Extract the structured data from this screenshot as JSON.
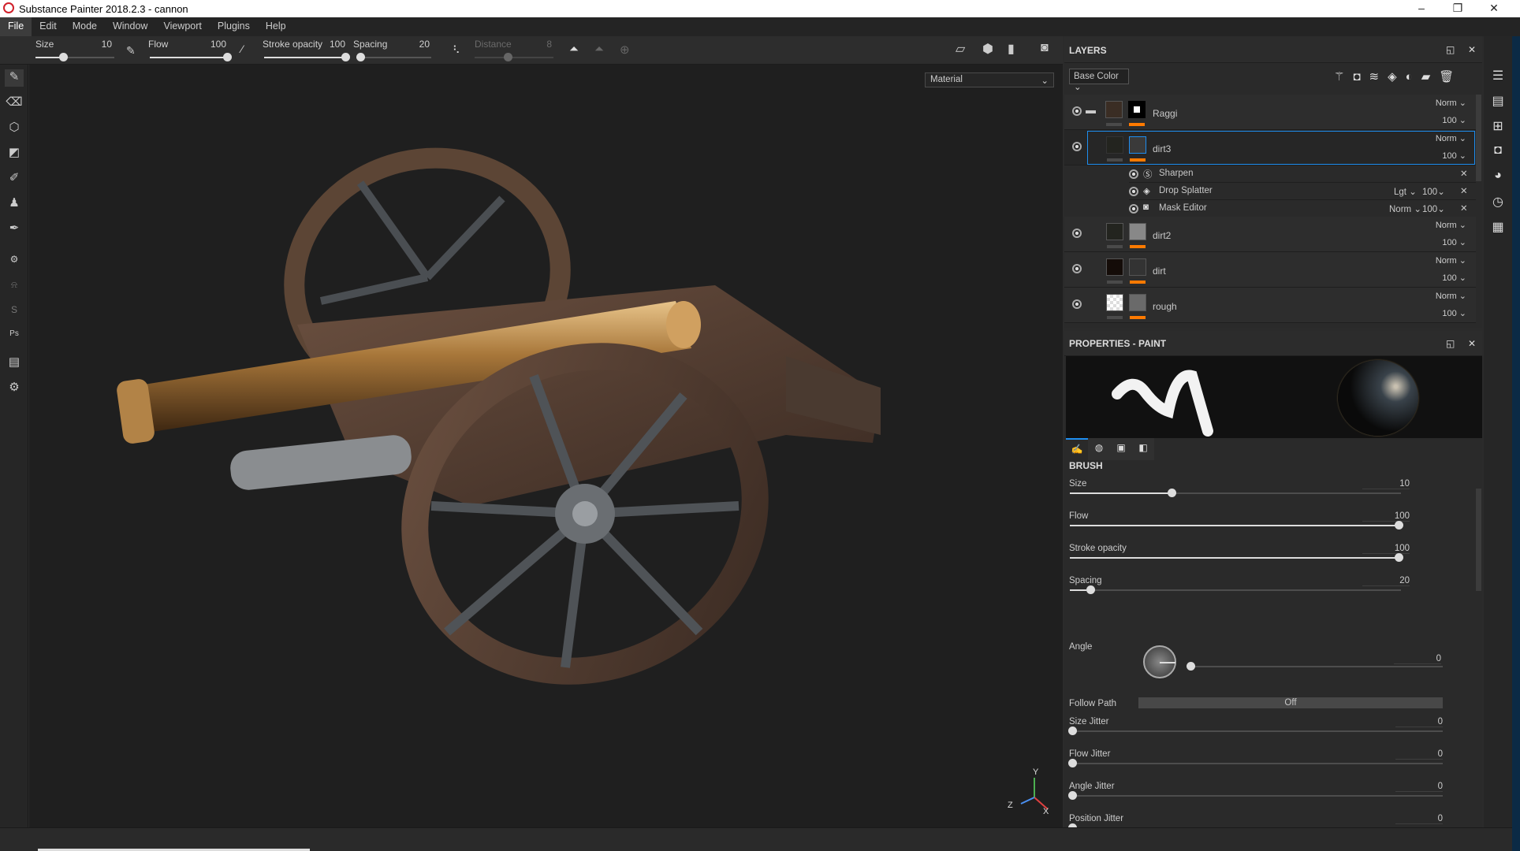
{
  "window": {
    "title": "Substance Painter 2018.2.3 - cannon",
    "minimize": "–",
    "maximize": "❐",
    "close": "✕"
  },
  "menu": [
    "File",
    "Edit",
    "Mode",
    "Window",
    "Viewport",
    "Plugins",
    "Help"
  ],
  "toolbar": {
    "size_label": "Size",
    "size_value": "10",
    "size_fraction": 0.35,
    "flow_label": "Flow",
    "flow_value": "100",
    "flow_fraction": 1.0,
    "stroke_label": "Stroke opacity",
    "stroke_value": "100",
    "stroke_fraction": 1.0,
    "spacing_label": "Spacing",
    "spacing_value": "20",
    "spacing_fraction": 0.05,
    "distance_label": "Distance",
    "distance_value": "8",
    "distance_fraction": 0.4
  },
  "viewport": {
    "channel": "Material",
    "axis_y": "Y",
    "axis_z": "Z",
    "axis_x": "X"
  },
  "layers": {
    "title": "LAYERS",
    "channel": "Base Color",
    "items": [
      {
        "name": "Raggi",
        "blend": "Norm",
        "opacity": "100"
      },
      {
        "name": "dirt3",
        "blend": "Norm",
        "opacity": "100"
      },
      {
        "name": "dirt2",
        "blend": "Norm",
        "opacity": "100"
      },
      {
        "name": "dirt",
        "blend": "Norm",
        "opacity": "100"
      },
      {
        "name": "rough",
        "blend": "Norm",
        "opacity": "100"
      }
    ],
    "effects": [
      {
        "name": "Sharpen",
        "blend": "",
        "opacity": ""
      },
      {
        "name": "Drop Splatter",
        "blend": "Lgt",
        "opacity": "100"
      },
      {
        "name": "Mask Editor",
        "blend": "Norm",
        "opacity": "100"
      }
    ]
  },
  "properties": {
    "title": "PROPERTIES - PAINT",
    "section": "BRUSH",
    "sliders": [
      {
        "label": "Size",
        "value": "10",
        "fraction": 0.3
      },
      {
        "label": "Flow",
        "value": "100",
        "fraction": 1.0
      },
      {
        "label": "Stroke opacity",
        "value": "100",
        "fraction": 1.0
      },
      {
        "label": "Spacing",
        "value": "20",
        "fraction": 0.05
      }
    ],
    "angle_label": "Angle",
    "angle_value": "0",
    "follow_path_label": "Follow Path",
    "follow_path_value": "Off",
    "jitters": [
      {
        "label": "Size Jitter",
        "value": "0"
      },
      {
        "label": "Flow Jitter",
        "value": "0"
      },
      {
        "label": "Angle Jitter",
        "value": "0"
      },
      {
        "label": "Position Jitter",
        "value": "0"
      }
    ]
  }
}
